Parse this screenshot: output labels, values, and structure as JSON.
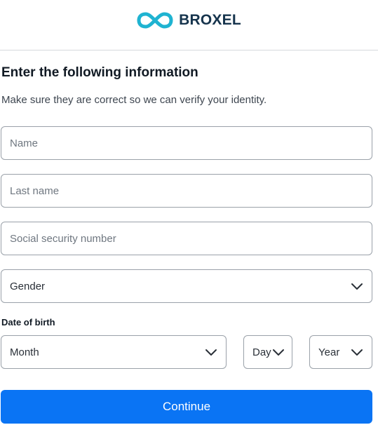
{
  "brand": {
    "name": "BROXEL",
    "logo_color": "#1fb3d1",
    "text_color": "#16344d"
  },
  "form": {
    "title": "Enter the following information",
    "subtitle": "Make sure they are correct so we can verify your identity.",
    "name_placeholder": "Name",
    "last_name_placeholder": "Last name",
    "ssn_placeholder": "Social security number",
    "gender_value": "Gender",
    "dob_label": "Date of birth",
    "month_value": "Month",
    "day_value": "Day",
    "year_value": "Year",
    "submit_label": "Continue"
  },
  "colors": {
    "primary": "#0a74f4",
    "border": "#9aa1a9"
  }
}
